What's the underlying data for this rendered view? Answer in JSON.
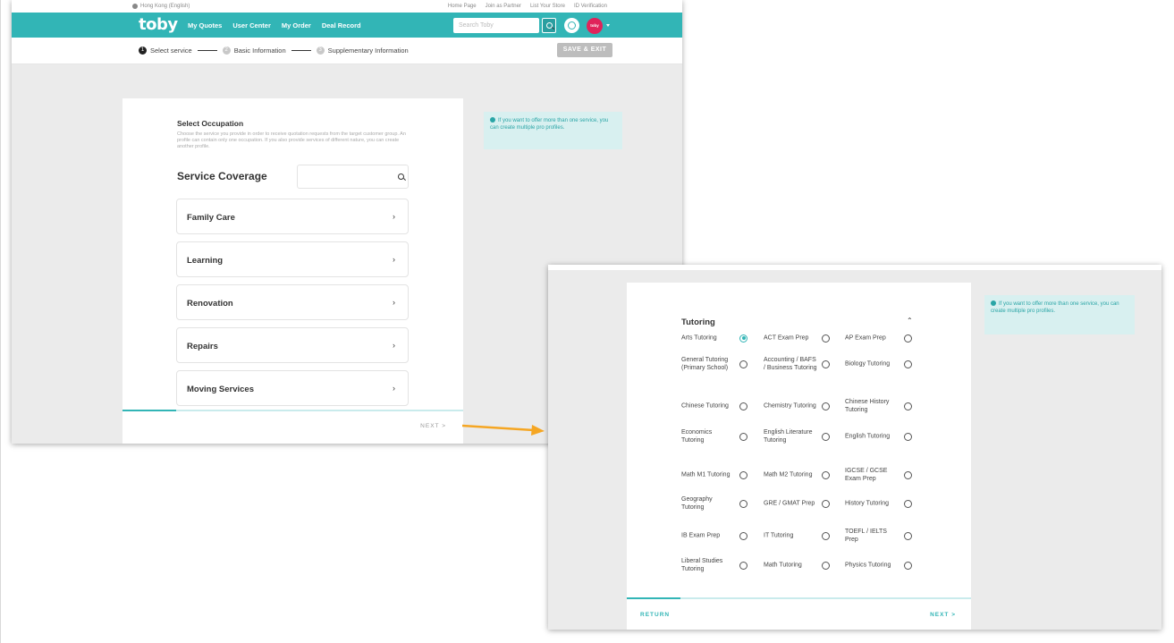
{
  "topbar": {
    "region": "Hong Kong (English)",
    "links": [
      "Home Page",
      "Join as Partner",
      "List Your Store",
      "ID Verification"
    ]
  },
  "nav": {
    "logo": "toby",
    "menu": [
      "My Quotes",
      "User Center",
      "My Order",
      "Deal Record"
    ],
    "search_placeholder": "Search Toby",
    "avatar_text": "toby"
  },
  "steps": [
    {
      "num": "1",
      "label": "Select service"
    },
    {
      "num": "2",
      "label": "Basic Information"
    },
    {
      "num": "3",
      "label": "Supplementary Information"
    }
  ],
  "save_exit": "SAVE & EXIT",
  "select_occupation": {
    "title": "Select Occupation",
    "description": "Choose the service you provide in order to receive quotation requests from the target customer group. An profile can contain only one occupation. If you also provide services of different nature, you can create another profile.",
    "coverage_title": "Service Coverage",
    "categories": [
      "Family Care",
      "Learning",
      "Renovation",
      "Repairs",
      "Moving Services"
    ],
    "next": "NEXT >"
  },
  "tip": "If you want to offer more than one service, you can create multiple pro profiles.",
  "tutoring": {
    "title": "Tutoring",
    "options": [
      {
        "label": "Arts Tutoring",
        "selected": true
      },
      {
        "label": "ACT Exam Prep",
        "selected": false
      },
      {
        "label": "AP Exam Prep",
        "selected": false
      },
      {
        "label": "General Tutoring (Primary School)",
        "selected": false
      },
      {
        "label": "Accounting / BAFS / Business Tutoring",
        "selected": false
      },
      {
        "label": "Biology Tutoring",
        "selected": false
      },
      {
        "label": "Chinese Tutoring",
        "selected": false
      },
      {
        "label": "Chemistry Tutoring",
        "selected": false
      },
      {
        "label": "Chinese History Tutoring",
        "selected": false
      },
      {
        "label": "Economics Tutoring",
        "selected": false
      },
      {
        "label": "English Literature Tutoring",
        "selected": false
      },
      {
        "label": "English Tutoring",
        "selected": false
      },
      {
        "label": "Math M1 Tutoring",
        "selected": false
      },
      {
        "label": "Math M2 Tutoring",
        "selected": false
      },
      {
        "label": "IGCSE / GCSE Exam Prep",
        "selected": false
      },
      {
        "label": "Geography Tutoring",
        "selected": false
      },
      {
        "label": "GRE / GMAT Prep",
        "selected": false
      },
      {
        "label": "History Tutoring",
        "selected": false
      },
      {
        "label": "IB Exam Prep",
        "selected": false
      },
      {
        "label": "IT Tutoring",
        "selected": false
      },
      {
        "label": "TOEFL / IELTS Prep",
        "selected": false
      },
      {
        "label": "Liberal Studies Tutoring",
        "selected": false
      },
      {
        "label": "Math Tutoring",
        "selected": false
      },
      {
        "label": "Physics Tutoring",
        "selected": false
      }
    ],
    "return": "RETURN",
    "next": "NEXT >"
  },
  "colors": {
    "accent": "#32b5b6",
    "avatar": "#e0235a",
    "arrow": "#f5a623",
    "tip_bg": "#d8f0f0"
  }
}
